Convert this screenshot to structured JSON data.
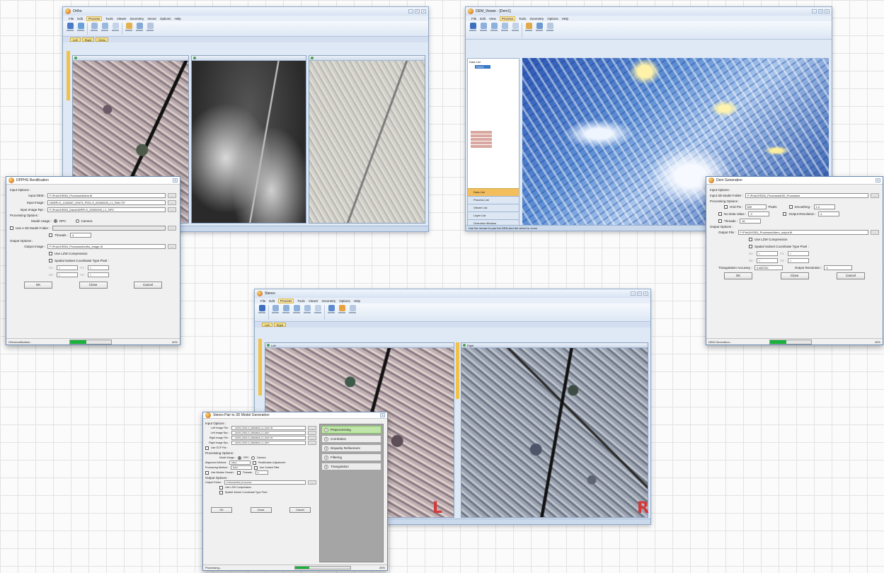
{
  "ortho_window": {
    "title": "Ortho",
    "menu": [
      "File",
      "Edit",
      "Process",
      "Tools",
      "Viewer",
      "Geometry",
      "Vector",
      "Options",
      "Help"
    ],
    "active_menu": "Process",
    "tabs": [
      "Left",
      "Right",
      "Ortho"
    ],
    "status": "Ready"
  },
  "ortho_dialog": {
    "title": "DPPHS Rectification",
    "input_section": "Input Options :",
    "input_dem_label": "Input DEM :",
    "input_dem_value": "F:\\Pra\\UHS5\\0_Processed\\dem.tif",
    "input_image_label": "Input Image :",
    "input_image_value": "HDRPLS_1234567_00073_P001-S_00000000_L1_PAN.TIF",
    "input_image_rpc_label": "Input Image Rpc :",
    "input_image_rpc_value": "F:\\Pra\\UHS5\\0_Data\\HDRPLS_00000000_L1_RPC",
    "processing_section": "Processing Options :",
    "model_usage_label": "Model Usage :",
    "model_opt_rpc": "RPC",
    "model_opt_camera": "Camera",
    "use_3d_model": "Use A 3D Model Folder :",
    "threads_label": "Threads :",
    "threads_value": "4",
    "output_section": "Output Options :",
    "output_image_label": "Output Image :",
    "output_image_value": "F:\\Pra\\UHS5\\0_Processed\\ortho_image.tif",
    "use_lzw": "Use LZW Compression",
    "spatial_subset": "Spatial Subset Coordinate Type Pixel :",
    "subset_labels": [
      "X1 :",
      "Y1 :",
      "X2 :",
      "Y2 :"
    ],
    "subset_values": [
      "0",
      "0",
      "0",
      "0"
    ],
    "ok": "OK",
    "close": "Close",
    "cancel": "Cancel",
    "status_text": "Orthorectification...",
    "progress_pct": 0.4,
    "progress_label": "40%"
  },
  "dem_window": {
    "title": "DEM_Viewer - [Dem1]",
    "menu": [
      "File",
      "Edit",
      "View",
      "Process",
      "Tools",
      "Geometry",
      "Options",
      "Help"
    ],
    "tree_root": "Data List",
    "tree_item": "Dem1",
    "panel_items": [
      "Data List",
      "Process List",
      "Viewer List",
      "Layer List",
      "Overview Window"
    ],
    "status": "Use the mouse to pan the DEM and the wheel to zoom"
  },
  "dem_dialog": {
    "title": "Dem Generation",
    "input_section": "Input Options :",
    "input_model_label": "Input 3D Model Folder :",
    "input_model_value": "F:\\Pra\\UHS5\\0_Processed\\3D_Processes",
    "processing_section": "Processing Options :",
    "grid_label": "Grid Pix :",
    "grid_value": "500",
    "pixels": "Pixels",
    "smoothing_label": "Smoothing :",
    "smoothing_value": "1.0",
    "no_data_label": "No Data Value :",
    "no_data_value": "0",
    "output_resolution_label": "Output Resolution :",
    "output_resolution_value": "4",
    "threads_label": "Threads :",
    "threads_value": "16",
    "output_section": "Output Options :",
    "output_file_label": "Output File :",
    "output_file_value": "F:\\Pra\\UHS5\\0_Processed\\dem_output.tif",
    "use_lzw": "Use LZW Compression",
    "spatial_subset": "Spatial Subset Coordinate Type Pixel :",
    "subset_labels": [
      "X1 :",
      "Y1 :",
      "X2 :",
      "Y2 :"
    ],
    "subset_values": [
      "0",
      "0",
      "0",
      "0"
    ],
    "triangulation_label": "Triangulation Accuracy :",
    "triangulation_value": "0.480762",
    "output_resolution2_label": "Output Resolution :",
    "output_resolution2_value": "4",
    "ok": "OK",
    "close": "Close",
    "cancel": "Cancel",
    "status_text": "DEM Generation...",
    "progress_pct": 0.4,
    "progress_label": "40%"
  },
  "stereo_window": {
    "title": "Stereo",
    "menu": [
      "File",
      "Edit",
      "Process",
      "Tools",
      "Viewer",
      "Geometry",
      "Options",
      "Help"
    ],
    "active_menu": "Process",
    "tabs": [
      "Left",
      "Right"
    ],
    "pane_left": "Left",
    "pane_right": "Right",
    "status": "Ready",
    "marker_left": "L",
    "marker_right": "R"
  },
  "stereo_dialog": {
    "title": "Stereo Pair to 3D Model Generation",
    "input_section": "Input Options :",
    "left_image_label": "Left Image File :",
    "left_image_value": "...00073_P001-S_00000000_L1_PAN.TIF",
    "left_rpc_label": "Left Image Rpc :",
    "left_rpc_value": "...00073_P001-S_00000000_L1_RPC",
    "right_image_label": "Right Image File :",
    "right_image_value": "...00074_P001-S_00000000_L1_PAN.TIF",
    "right_rpc_label": "Right Image Rpc :",
    "right_rpc_value": "...00074_P001-S_00000000_L1_RPC",
    "use_gcp": "Use GCP File :",
    "processing_section": "Processing Options :",
    "model_usage_label": "Model Usage :",
    "model_opt_rpc": "RPC",
    "model_opt_camera": "Camera",
    "alignment_label": "Alignment Method :",
    "alignment_value": "Affine",
    "rectification": "Rectification Adjustment",
    "processing_method_label": "Processing Method :",
    "processing_method_value": "SGM",
    "use_guided": "Use Guided Filter",
    "use_median": "Use Median Search :",
    "threads_label": "Threads :",
    "threads_value": "4",
    "output_section": "Output Options :",
    "output_folder_label": "Output Folder :",
    "output_folder_value": "F:\\Pra\\UHS5\\0_Processed",
    "use_lzw": "Use LZW Compression",
    "spatial_subset": "Spatial Subset Coordinate Type Pixel :",
    "steps": [
      "Preprocessing",
      "Correlation",
      "Disparity Refinement",
      "Filtering",
      "Triangulation"
    ],
    "ok": "OK",
    "close": "Close",
    "cancel": "Cancel",
    "status_text": "Processing...",
    "progress_pct": 0.25,
    "progress_label": "25%"
  }
}
